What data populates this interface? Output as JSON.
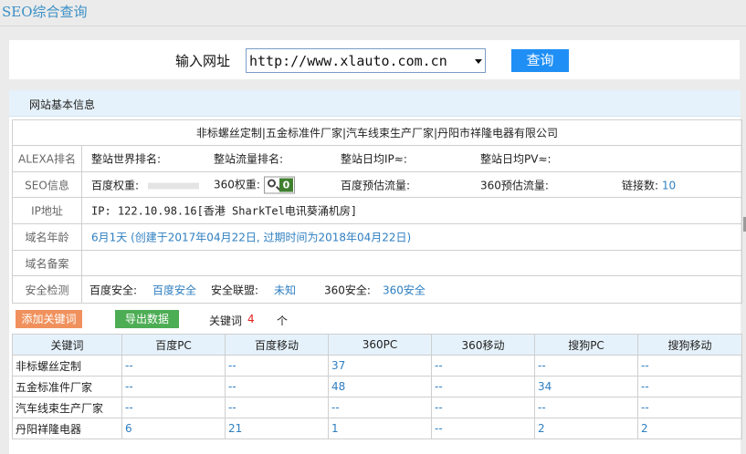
{
  "page_title": "SEO综合查询",
  "query": {
    "label": "输入网址",
    "url": "http://www.xlauto.com.cn",
    "button": "查询"
  },
  "panel": {
    "header": "网站基本信息",
    "site_title": "非标螺丝定制|五金标准件厂家|汽车线束生产厂家|丹阳市祥隆电器有限公司",
    "rows": {
      "alexa": {
        "label": "ALEXA排名",
        "world_rank": "整站世界排名:",
        "traffic_rank": "整站流量排名:",
        "daily_ip": "整站日均IP≈:",
        "daily_pv": "整站日均PV≈:"
      },
      "seo": {
        "label": "SEO信息",
        "baidu_weight": "百度权重:",
        "weight_360": "360权重:",
        "weight_360_value": "0",
        "baidu_traffic": "百度预估流量:",
        "traffic_360": "360预估流量:",
        "links_label": "链接数:",
        "links_value": "10"
      },
      "ip": {
        "label": "IP地址",
        "value": "IP: 122.10.98.16[香港 SharkTel电讯葵涌机房]"
      },
      "domain_age": {
        "label": "域名年龄",
        "value": "6月1天 (创建于2017年04月22日, 过期时间为2018年04月22日)"
      },
      "icp": {
        "label": "域名备案"
      },
      "security": {
        "label": "安全检测",
        "baidu_label": "百度安全:",
        "baidu_value": "百度安全",
        "union_label": "安全联盟:",
        "union_value": "未知",
        "s360_label": "360安全:",
        "s360_value": "360安全"
      }
    }
  },
  "keywords": {
    "add_button": "添加关键词",
    "export_button": "导出数据",
    "count_label": "关键词",
    "count": "4",
    "count_unit": "个",
    "columns": [
      "关键词",
      "百度PC",
      "百度移动",
      "360PC",
      "360移动",
      "搜狗PC",
      "搜狗移动"
    ],
    "rows": [
      [
        "非标螺丝定制",
        "--",
        "--",
        "37",
        "--",
        "--",
        "--"
      ],
      [
        "五金标准件厂家",
        "--",
        "--",
        "48",
        "--",
        "34",
        "--"
      ],
      [
        "汽车线束生产厂家",
        "--",
        "--",
        "--",
        "--",
        "--",
        "--"
      ],
      [
        "丹阳祥隆电器",
        "6",
        "21",
        "1",
        "--",
        "2",
        "2"
      ]
    ]
  }
}
